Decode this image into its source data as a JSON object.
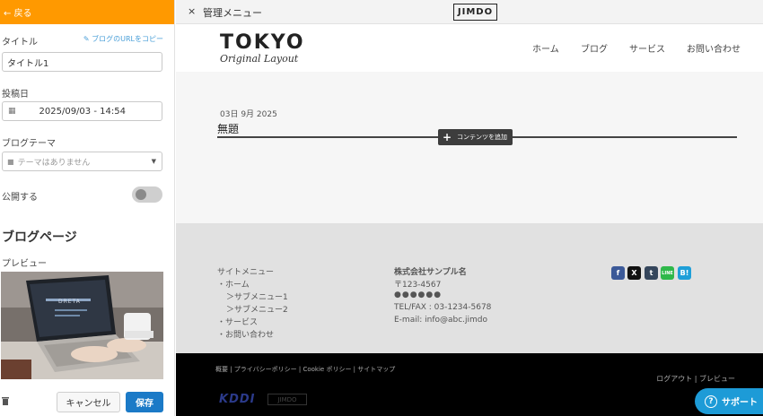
{
  "sidebar": {
    "back_label": "← 戻る",
    "title_label": "タイトル",
    "blog_url_link": "✎ ブログのURLをコピー",
    "title_value": "タイトル1",
    "post_date_label": "投稿日",
    "post_date_value": "2025/09/03 - 14:54",
    "theme_label": "ブログテーマ",
    "theme_placeholder": "テーマはありません",
    "publish_label": "公開する",
    "publish_on": false,
    "blog_page_heading": "ブログページ",
    "preview_label": "プレビュー",
    "preview_logo_text": "DRETA"
  },
  "footer_actions": {
    "cancel_label": "キャンセル",
    "save_label": "保存"
  },
  "topbar": {
    "close_icon": "×",
    "title": "管理メニュー",
    "logo": "JIMDO"
  },
  "site": {
    "logo_main": "TOKYO",
    "logo_sub": "Original Layout",
    "nav": [
      "ホーム",
      "ブログ",
      "サービス",
      "お問い合わせ"
    ],
    "post_date": "03日 9月 2025",
    "post_title": "無題",
    "add_content_label": "コンテンツを追加",
    "footer_menu_title": "サイトメニュー",
    "footer_menu": [
      "・ホーム",
      "＞サブメニュー1",
      "＞サブメニュー2",
      "・サービス",
      "・お問い合わせ"
    ],
    "company_name": "株式会社サンプル名",
    "postal": "〒123-4567",
    "address_masked": "●●●●●●",
    "tel_fax": "TEL/FAX : 03-1234-5678",
    "email": "E-mail: info@abc.jimdo",
    "social": [
      {
        "label": "f",
        "color": "#3b5998",
        "icon": "facebook-icon"
      },
      {
        "label": "X",
        "color": "#111111",
        "icon": "x-icon"
      },
      {
        "label": "t",
        "color": "#35465c",
        "icon": "tumblr-icon"
      },
      {
        "label": "LINE",
        "color": "#2fb84a",
        "icon": "line-icon"
      },
      {
        "label": "B!",
        "color": "#1e9fd8",
        "icon": "hatena-icon"
      }
    ],
    "bottom_links": "概要 | プライバシーポリシー | Cookie ポリシー | サイトマップ",
    "bottom_right": "ログアウト | ブレビュー",
    "kddi_logo": "KDDI",
    "jimdo_small": "JIMDO"
  },
  "support": {
    "label": "サポート",
    "icon": "?"
  },
  "colors": {
    "header_orange": "#ff9900",
    "save_blue": "#1b7ac7",
    "support_blue": "#1d9bd7"
  }
}
